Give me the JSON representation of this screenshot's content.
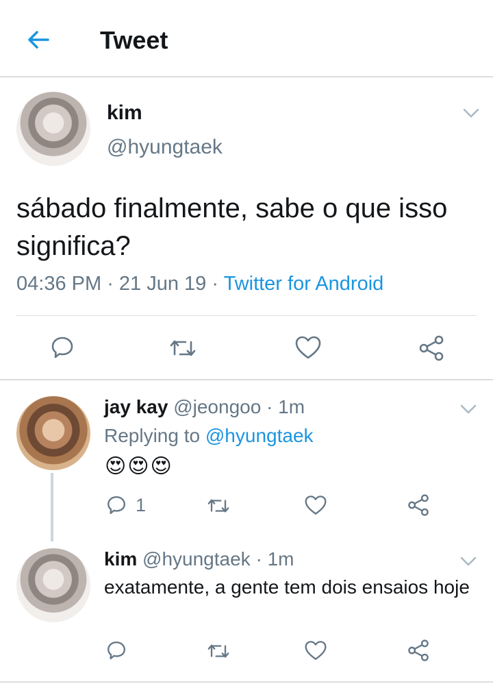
{
  "header": {
    "title": "Tweet"
  },
  "main_tweet": {
    "name": "kim",
    "handle": "@hyungtaek",
    "text": "sábado finalmente, sabe o que isso significa?",
    "time": "04:36 PM",
    "sep1": " · ",
    "date": "21 Jun 19",
    "sep2": " · ",
    "client": "Twitter for Android"
  },
  "reply1": {
    "name": "jay kay",
    "handle": "@jeongoo",
    "sep": " · ",
    "time": "1m",
    "replying_label": "Replying to ",
    "replying_to": "@hyungtaek",
    "emojis": "😍😍😍",
    "reply_count": "1"
  },
  "reply2": {
    "name": "kim",
    "handle": "@hyungtaek",
    "sep": " · ",
    "time": "1m",
    "text": "exatamente, a gente tem dois ensaios hoje"
  },
  "colors": {
    "accent": "#1b95e0",
    "secondary": "#657786",
    "divider": "#d9dde0"
  },
  "icons": [
    "back-arrow-icon",
    "chevron-down-icon",
    "reply-icon",
    "retweet-icon",
    "like-icon",
    "share-icon"
  ]
}
